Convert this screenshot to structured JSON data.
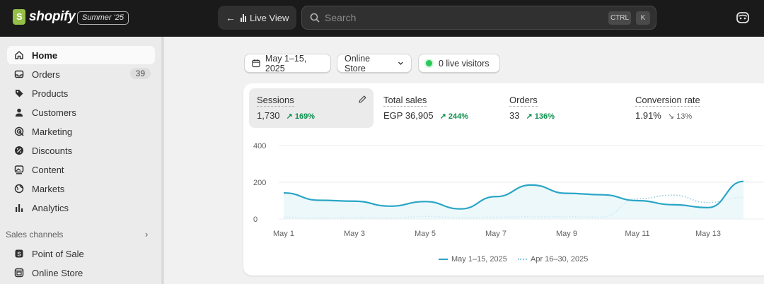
{
  "topbar": {
    "brand": "shopify",
    "edition": "Summer '25",
    "live_view_label": "Live View",
    "search_placeholder": "Search",
    "shortcut_keys": [
      "CTRL",
      "K"
    ]
  },
  "sidebar": {
    "items": [
      {
        "label": "Home",
        "icon": "home-icon",
        "active": true
      },
      {
        "label": "Orders",
        "icon": "inbox-icon",
        "badge": "39"
      },
      {
        "label": "Products",
        "icon": "tag-icon"
      },
      {
        "label": "Customers",
        "icon": "person-icon"
      },
      {
        "label": "Marketing",
        "icon": "target-icon"
      },
      {
        "label": "Discounts",
        "icon": "discount-icon"
      },
      {
        "label": "Content",
        "icon": "image-icon"
      },
      {
        "label": "Markets",
        "icon": "globe-icon"
      },
      {
        "label": "Analytics",
        "icon": "bar-chart-icon"
      }
    ],
    "sales_channels_title": "Sales channels",
    "channels": [
      {
        "label": "Point of Sale",
        "icon": "pos-icon"
      },
      {
        "label": "Online Store",
        "icon": "store-icon"
      }
    ]
  },
  "filters": {
    "date_range": "May 1–15, 2025",
    "channel": "Online Store",
    "live_visitors": "0 live visitors"
  },
  "metrics": [
    {
      "label": "Sessions",
      "value": "1,730",
      "change": "169%",
      "direction": "up",
      "active": true
    },
    {
      "label": "Total sales",
      "value": "EGP 36,905",
      "change": "244%",
      "direction": "up"
    },
    {
      "label": "Orders",
      "value": "33",
      "change": "136%",
      "direction": "up"
    },
    {
      "label": "Conversion rate",
      "value": "1.91%",
      "change": "13%",
      "direction": "down"
    }
  ],
  "colors": {
    "accent_line": "#2aa5c6",
    "compare_line": "#8fc9db",
    "positive": "#0c8f4d",
    "live_dot": "#29c85a"
  },
  "chart_data": {
    "type": "line",
    "y_ticks": [
      "400",
      "200",
      "0"
    ],
    "ylim": [
      0,
      400
    ],
    "x_tick_labels": [
      "May 1",
      "May 3",
      "May 5",
      "May 7",
      "May 9",
      "May 11",
      "May 13"
    ],
    "x": [
      "May 1",
      "May 2",
      "May 3",
      "May 4",
      "May 5",
      "May 6",
      "May 7",
      "May 8",
      "May 9",
      "May 10",
      "May 11",
      "May 12",
      "May 13",
      "May 14"
    ],
    "series": [
      {
        "name": "May 1–15, 2025",
        "style": "solid",
        "values": [
          142,
          102,
          97,
          70,
          95,
          55,
          122,
          185,
          140,
          132,
          100,
          78,
          62,
          205
        ]
      },
      {
        "name": "Apr 16–30, 2025",
        "style": "dotted",
        "values": [
          10,
          5,
          8,
          5,
          14,
          8,
          10,
          12,
          12,
          10,
          110,
          130,
          90,
          118
        ]
      }
    ]
  }
}
